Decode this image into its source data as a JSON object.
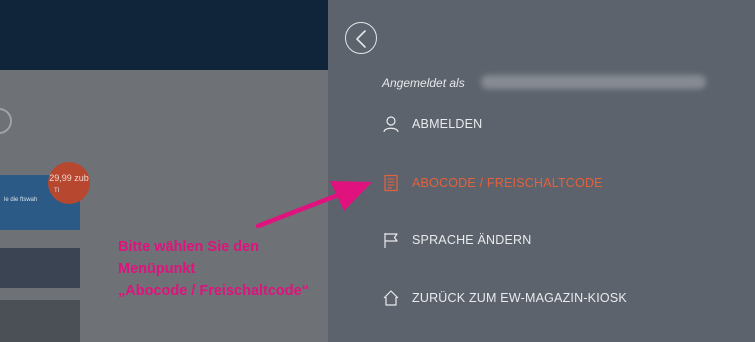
{
  "background": {
    "price_badge": "29,99 zub",
    "card_label": "TI",
    "card_text": "le die ftswah"
  },
  "menu": {
    "logged_in_label": "Angemeldet als",
    "items": [
      {
        "label": "ABMELDEN",
        "icon": "user-icon",
        "active": false
      },
      {
        "label": "ABOCODE / FREISCHALTCODE",
        "icon": "document-icon",
        "active": true
      },
      {
        "label": "SPRACHE ÄNDERN",
        "icon": "flag-icon",
        "active": false
      },
      {
        "label": "ZURÜCK ZUM EW-MAGAZIN-KIOSK",
        "icon": "home-icon",
        "active": false
      }
    ],
    "back_icon": "chevron-left-icon"
  },
  "annotation": {
    "lines": [
      "Bitte wählen Sie den",
      "Menüpunkt",
      "„Abocode / Freischaltcode“"
    ]
  },
  "colors": {
    "panel_bg": "#5d636c",
    "accent_orange": "#e3613c",
    "annotation_magenta": "#e0127e",
    "header_navy": "#10253a"
  }
}
